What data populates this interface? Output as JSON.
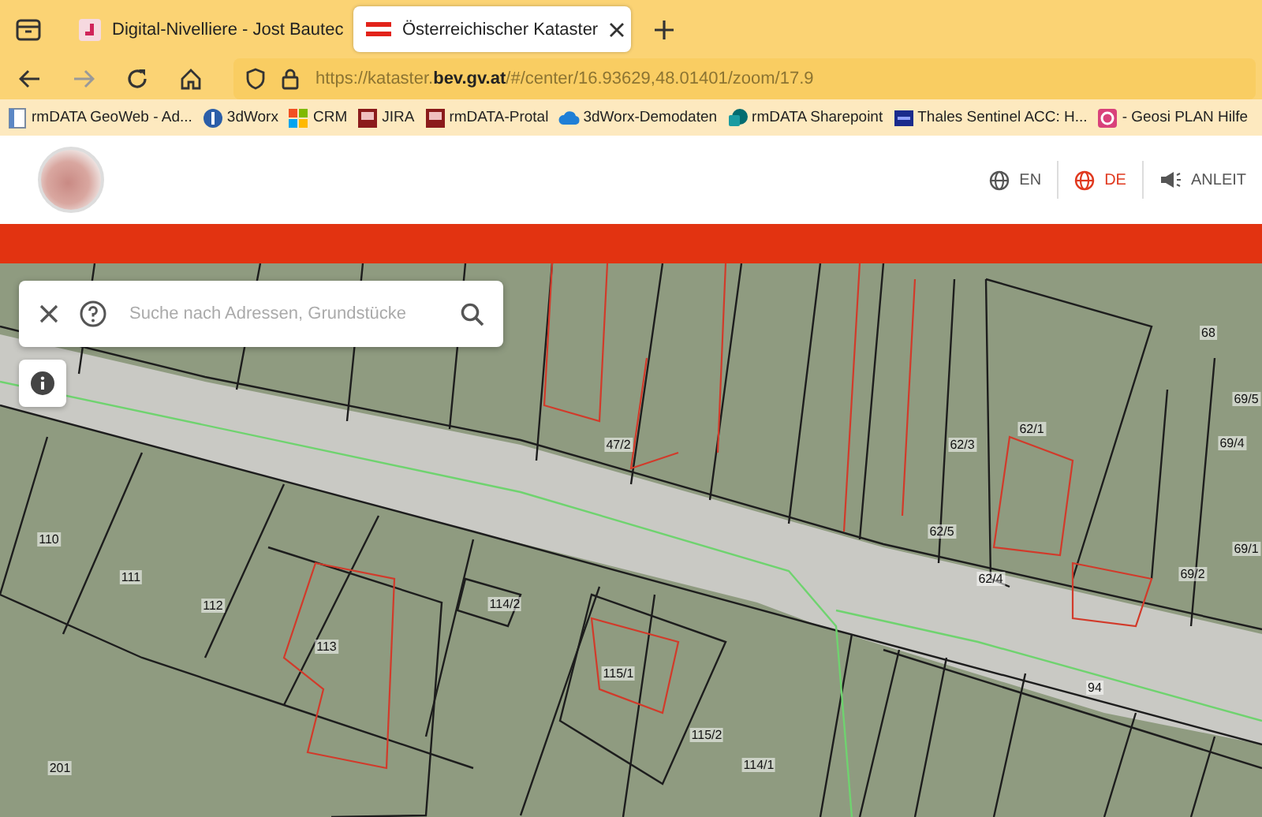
{
  "browser": {
    "tabs": [
      {
        "label": "Digital-Nivelliere - Jost Bautec",
        "selected": false
      },
      {
        "label": "Österreichischer Kataster",
        "selected": true
      }
    ],
    "url": "https://kataster.**bev.gv.at**/#/center/16.93629,48.01401/zoom/17.9",
    "bookmarks": [
      "rmDATA GeoWeb - Ad...",
      "3dWorx",
      "CRM",
      "JIRA",
      "rmDATA-Protal",
      "3dWorx-Demodaten",
      "rmDATA Sharepoint",
      "Thales Sentinel ACC: H...",
      "- Geosi PLAN Hilfe"
    ]
  },
  "header": {
    "languages": [
      {
        "label": "EN",
        "selected": false
      },
      {
        "label": "DE",
        "selected": true
      }
    ],
    "guide_label": "ANLEIT"
  },
  "search": {
    "placeholder": "Suche nach Adressen, Grundstücke"
  },
  "map": {
    "parcels": [
      "47/2",
      "62/3",
      "62/1",
      "68",
      "69/5",
      "69/4",
      "69/1",
      "62/5",
      "62/4",
      "69/2",
      "110",
      "111",
      "112",
      "113",
      "114/2",
      "115/1",
      "115/2",
      "114/1",
      "94",
      "201"
    ]
  }
}
